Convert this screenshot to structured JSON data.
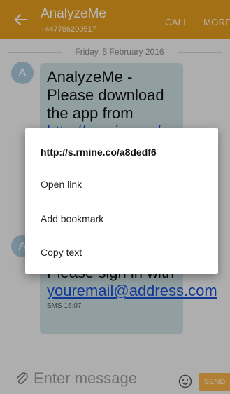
{
  "colors": {
    "accent": "#e39b1e",
    "bubble": "#c9dde0",
    "avatar": "#a9c6d9",
    "link": "#1a4fd6",
    "send": "#f5b24a"
  },
  "appbar": {
    "back_icon": "arrow-left-icon",
    "contact_name": "AnalyzeMe",
    "contact_number": "+447786200517",
    "call_label": "CALL",
    "more_label": "MORE"
  },
  "conversation": {
    "date": "Friday, 5 February 2016",
    "messages": [
      {
        "avatar_letter": "A",
        "text": "AnalyzeMe - Please download the app from",
        "link_fragment": "http://s.rmine.co/a"
      },
      {
        "avatar_letter": "A",
        "text": "Please sign in with",
        "link": "youremail@address.com",
        "meta": "SMS 16:07"
      }
    ]
  },
  "context_menu": {
    "title": "http://s.rmine.co/a8dedf6",
    "items": [
      {
        "label": "Open link"
      },
      {
        "label": "Add bookmark"
      },
      {
        "label": "Copy text"
      }
    ]
  },
  "composer": {
    "attach_icon": "paperclip-icon",
    "placeholder": "Enter message",
    "emoji_icon": "smiley-icon",
    "send_label": "SEND"
  }
}
